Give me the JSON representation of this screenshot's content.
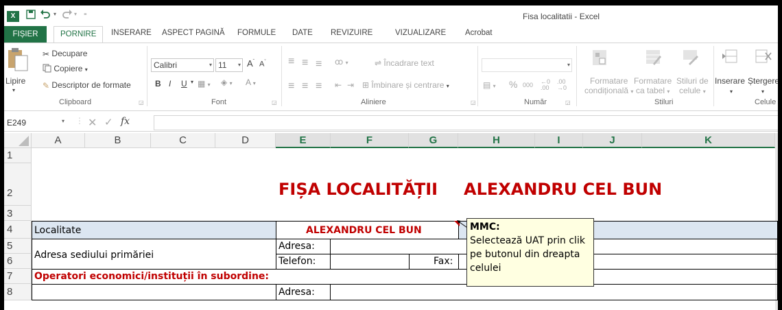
{
  "app": {
    "window_title": "Fisa localitatii - Excel",
    "logo_text": "X",
    "tabs": [
      "FIȘIER",
      "PORNIRE",
      "INSERARE",
      "ASPECT PAGINĂ",
      "FORMULE",
      "DATE",
      "REVIZUIRE",
      "VIZUALIZARE",
      "Acrobat"
    ],
    "active_tab": "PORNIRE"
  },
  "ribbon": {
    "clipboard": {
      "paste": "Lipire",
      "cut": "Decupare",
      "copy": "Copiere",
      "format_painter": "Descriptor de formate",
      "group": "Clipboard"
    },
    "font": {
      "name": "Calibri",
      "size": "11",
      "group": "Font"
    },
    "alignment": {
      "wrap": "Încadrare text",
      "merge": "Îmbinare și centrare",
      "group": "Aliniere"
    },
    "number": {
      "percent": "%",
      "thousands": "000",
      "group": "Număr"
    },
    "styles": {
      "conditional": [
        "Formatare",
        "condițională"
      ],
      "as_table": [
        "Formatare",
        "ca tabel"
      ],
      "cell_styles": [
        "Stiluri de",
        "celule"
      ],
      "group": "Stiluri"
    },
    "cells": {
      "insert": "Inserare",
      "delete": "Ștergere",
      "group": "Celule"
    }
  },
  "formula_bar": {
    "name_box": "E249",
    "fx": "fx",
    "formula": ""
  },
  "columns": [
    "A",
    "B",
    "C",
    "D",
    "E",
    "F",
    "G",
    "H",
    "I",
    "J",
    "K"
  ],
  "selected_column": "E",
  "rows": [
    "1",
    "2",
    "3",
    "4",
    "5",
    "6",
    "7",
    "8"
  ],
  "sheet": {
    "title_left": "FIȘA LOCALITĂȚII",
    "title_right": "ALEXANDRU CEL BUN",
    "localitate_label": "Localitate",
    "localitate_value": "ALEXANDRU CEL BUN",
    "adresa_label": "Adresa sediului primăriei",
    "adresa": "Adresa:",
    "telefon": "Telefon:",
    "fax": "Fax:",
    "operatori": "Operatori economici/instituții în subordine:",
    "adresa_row8": "Adresa:"
  },
  "comment": {
    "author": "MMC:",
    "lines": [
      "Selectează UAT prin clik",
      "pe butonul din dreapta",
      "celulei"
    ]
  },
  "colors": {
    "excel_green": "#217346",
    "title_red": "#c00000",
    "header_fill": "#dce6f1",
    "comment_fill": "#ffffe1"
  }
}
